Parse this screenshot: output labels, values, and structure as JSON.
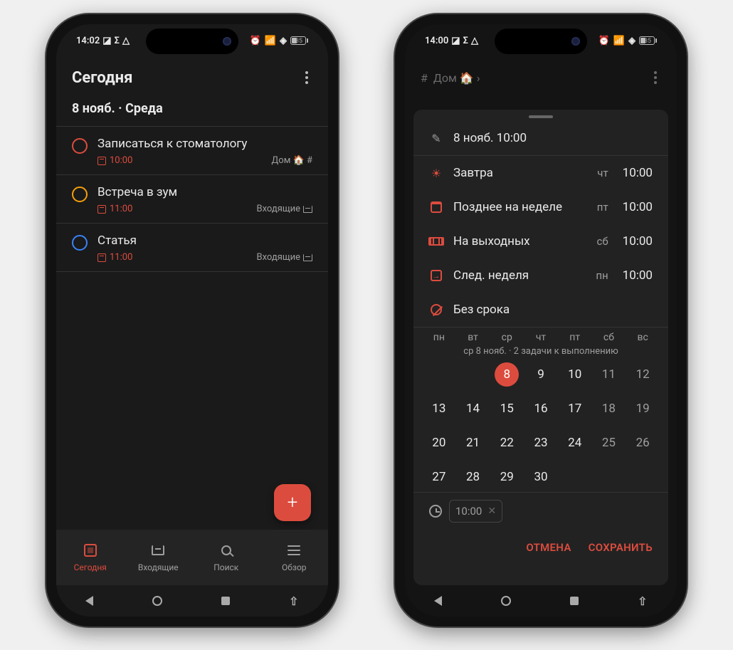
{
  "statusbar": {
    "time": "14:02",
    "battery": "35"
  },
  "phone1": {
    "header": "Сегодня",
    "date": "8 нояб. · Среда",
    "tasks": [
      {
        "color": "red",
        "title": "Записаться к стоматологу",
        "time": "10:00",
        "project": "Дом 🏠 #"
      },
      {
        "color": "orange",
        "title": "Встреча в зум",
        "time": "11:00",
        "project": "Входящие"
      },
      {
        "color": "blue",
        "title": "Статья",
        "time": "11:00",
        "project": "Входящие"
      }
    ],
    "nav": {
      "today": "Сегодня",
      "inbox": "Входящие",
      "search": "Поиск",
      "overview": "Обзор"
    }
  },
  "phone2": {
    "statusbar_time": "14:00",
    "breadcrumb": "Дом 🏠 ›",
    "edit_date": "8 нояб. 10:00",
    "quick": [
      {
        "icon": "sun",
        "label": "Завтра",
        "day": "чт",
        "time": "10:00"
      },
      {
        "icon": "cal",
        "label": "Позднее на неделе",
        "day": "пт",
        "time": "10:00"
      },
      {
        "icon": "sofa",
        "label": "На выходных",
        "day": "сб",
        "time": "10:00"
      },
      {
        "icon": "arrow",
        "label": "След. неделя",
        "day": "пн",
        "time": "10:00"
      },
      {
        "icon": "none",
        "label": "Без срока",
        "day": "",
        "time": ""
      }
    ],
    "weekdays": [
      "пн",
      "вт",
      "ср",
      "чт",
      "пт",
      "сб",
      "вс"
    ],
    "caption": "ср 8 нояб. · 2 задачи к выполнению",
    "days": [
      [
        "",
        "",
        "8",
        "9",
        "10",
        "11",
        "12"
      ],
      [
        "13",
        "14",
        "15",
        "16",
        "17",
        "18",
        "19"
      ],
      [
        "20",
        "21",
        "22",
        "23",
        "24",
        "25",
        "26"
      ],
      [
        "27",
        "28",
        "29",
        "30",
        "",
        "",
        ""
      ]
    ],
    "selected": "8",
    "timechip": "10:00",
    "cancel": "ОТМЕНА",
    "save": "СОХРАНИТЬ"
  }
}
